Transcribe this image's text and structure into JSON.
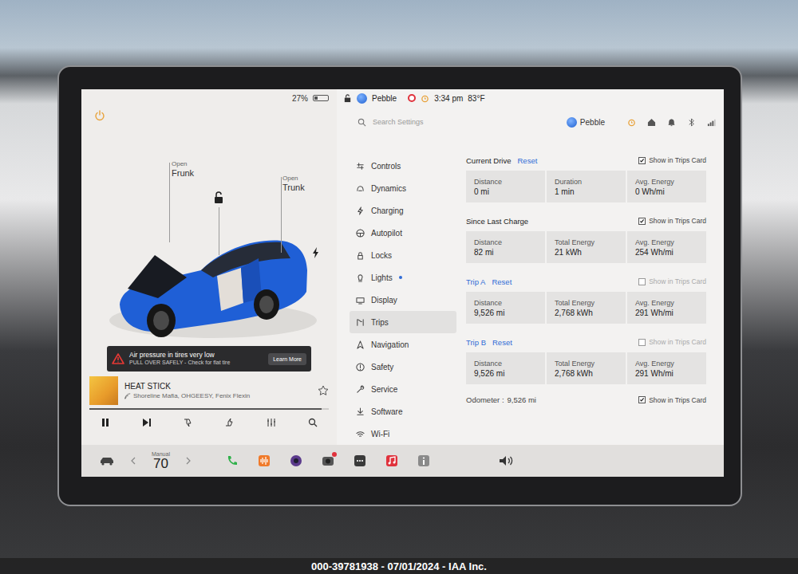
{
  "statusBar": {
    "battery": "27%",
    "profile": "Pebble",
    "time": "3:34 pm",
    "temperature": "83°F"
  },
  "car": {
    "frunk": {
      "label": "Open",
      "part": "Frunk"
    },
    "trunk": {
      "label": "Open",
      "part": "Trunk"
    },
    "locked": false,
    "charging": true
  },
  "alert": {
    "title": "Air pressure in tires very low",
    "subtitle": "PULL OVER SAFELY - Check for flat tire",
    "button": "Learn More"
  },
  "media": {
    "title": "HEAT STICK",
    "artist": "Shoreline Mafia, OHGEESY, Fenix Flexin",
    "progress": 0.97,
    "favorite": false
  },
  "dock": {
    "mode": "Manual",
    "temperature": "70"
  },
  "settings": {
    "search": {
      "placeholder": "Search Settings"
    },
    "profile": "Pebble",
    "menu": [
      {
        "label": "Controls",
        "selected": false,
        "dot": false
      },
      {
        "label": "Dynamics",
        "selected": false,
        "dot": false
      },
      {
        "label": "Charging",
        "selected": false,
        "dot": false
      },
      {
        "label": "Autopilot",
        "selected": false,
        "dot": false
      },
      {
        "label": "Locks",
        "selected": false,
        "dot": false
      },
      {
        "label": "Lights",
        "selected": false,
        "dot": true
      },
      {
        "label": "Display",
        "selected": false,
        "dot": false
      },
      {
        "label": "Trips",
        "selected": true,
        "dot": false
      },
      {
        "label": "Navigation",
        "selected": false,
        "dot": false
      },
      {
        "label": "Safety",
        "selected": false,
        "dot": false
      },
      {
        "label": "Service",
        "selected": false,
        "dot": false
      },
      {
        "label": "Software",
        "selected": false,
        "dot": false
      },
      {
        "label": "Wi-Fi",
        "selected": false,
        "dot": false
      }
    ],
    "showLabel": "Show in Trips Card",
    "sections": [
      {
        "title": "Current Drive",
        "kind": "fixed",
        "reset": "Reset",
        "show": true,
        "cells": [
          {
            "label": "Distance",
            "value": "0 mi"
          },
          {
            "label": "Duration",
            "value": "1 min"
          },
          {
            "label": "Avg. Energy",
            "value": "0 Wh/mi"
          }
        ]
      },
      {
        "title": "Since Last Charge",
        "kind": "fixed",
        "reset": null,
        "show": true,
        "cells": [
          {
            "label": "Distance",
            "value": "82 mi"
          },
          {
            "label": "Total Energy",
            "value": "21 kWh"
          },
          {
            "label": "Avg. Energy",
            "value": "254 Wh/mi"
          }
        ]
      },
      {
        "title": "Trip A",
        "kind": "trip",
        "reset": "Reset",
        "show": false,
        "cells": [
          {
            "label": "Distance",
            "value": "9,526 mi"
          },
          {
            "label": "Total Energy",
            "value": "2,768 kWh"
          },
          {
            "label": "Avg. Energy",
            "value": "291 Wh/mi"
          }
        ]
      },
      {
        "title": "Trip B",
        "kind": "trip",
        "reset": "Reset",
        "show": false,
        "cells": [
          {
            "label": "Distance",
            "value": "9,526 mi"
          },
          {
            "label": "Total Energy",
            "value": "2,768 kWh"
          },
          {
            "label": "Avg. Energy",
            "value": "291 Wh/mi"
          }
        ]
      }
    ],
    "odometer": {
      "label": "Odometer :",
      "value": "9,526 mi",
      "show": true
    }
  },
  "watermark": "000-39781938 - 07/01/2024 - IAA Inc."
}
